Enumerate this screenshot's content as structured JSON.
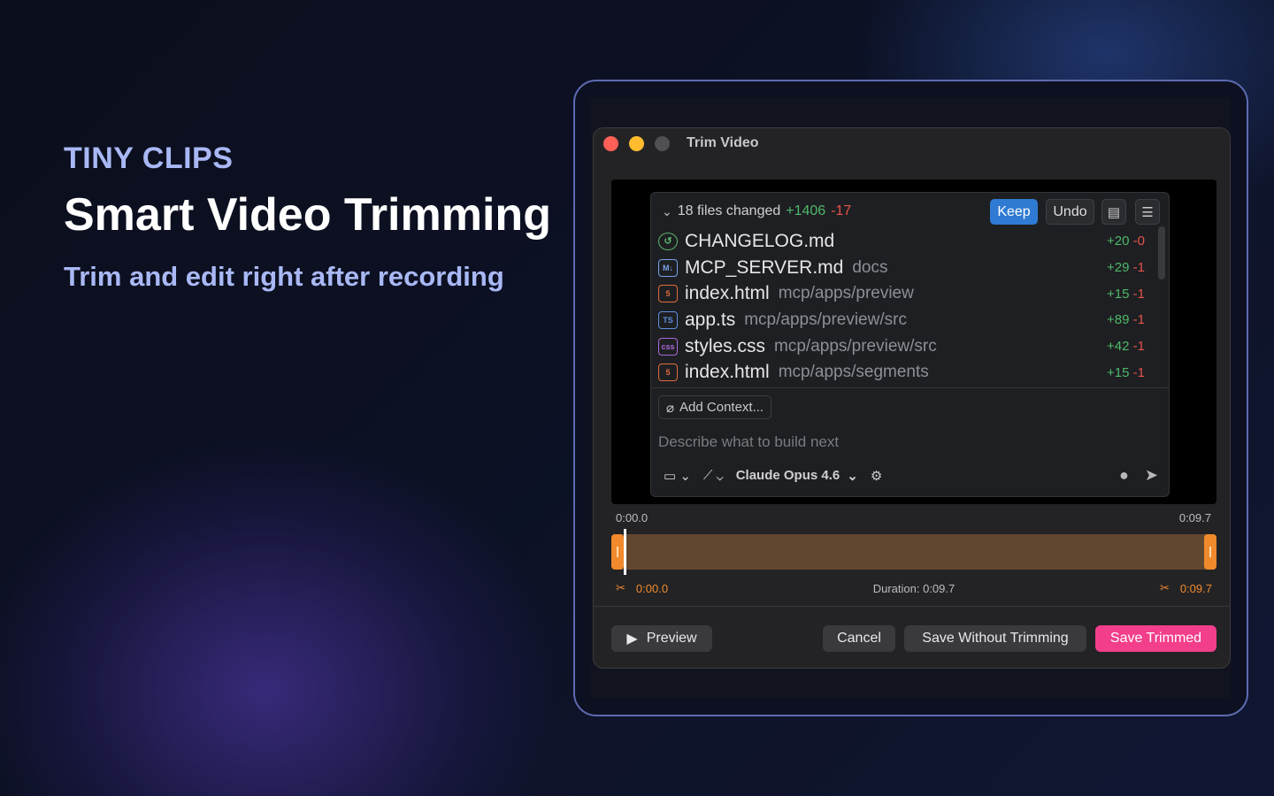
{
  "hero": {
    "brand": "TINY CLIPS",
    "headline": "Smart Video Trimming",
    "subline": "Trim and edit right after recording"
  },
  "window": {
    "title": "Trim Video"
  },
  "recording": {
    "summary": "18 files changed",
    "added": "+1406",
    "removed": "-17",
    "keep_label": "Keep",
    "undo_label": "Undo",
    "files": [
      {
        "icon": "clock",
        "name": "CHANGELOG.md",
        "path": "",
        "add": "+20",
        "del": "-0"
      },
      {
        "icon": "md",
        "name": "MCP_SERVER.md",
        "path": "docs",
        "add": "+29",
        "del": "-1"
      },
      {
        "icon": "html",
        "name": "index.html",
        "path": "mcp/apps/preview",
        "add": "+15",
        "del": "-1"
      },
      {
        "icon": "ts",
        "name": "app.ts",
        "path": "mcp/apps/preview/src",
        "add": "+89",
        "del": "-1"
      },
      {
        "icon": "css",
        "name": "styles.css",
        "path": "mcp/apps/preview/src",
        "add": "+42",
        "del": "-1"
      },
      {
        "icon": "html",
        "name": "index.html",
        "path": "mcp/apps/segments",
        "add": "+15",
        "del": "-1"
      }
    ],
    "add_context": "Add Context...",
    "placeholder": "Describe what to build next",
    "model": "Claude Opus 4.6"
  },
  "timeline": {
    "start_time": "0:00.0",
    "end_time": "0:09.7",
    "trim_start": "0:00.0",
    "trim_end": "0:09.7",
    "duration": "Duration: 0:09.7"
  },
  "actions": {
    "preview": "Preview",
    "cancel": "Cancel",
    "save_without": "Save Without Trimming",
    "save_trimmed": "Save Trimmed"
  },
  "colors": {
    "accent_pink": "#f23e8b",
    "trim_orange": "#f08a2c",
    "brand_lavender": "#a9b8f5"
  }
}
